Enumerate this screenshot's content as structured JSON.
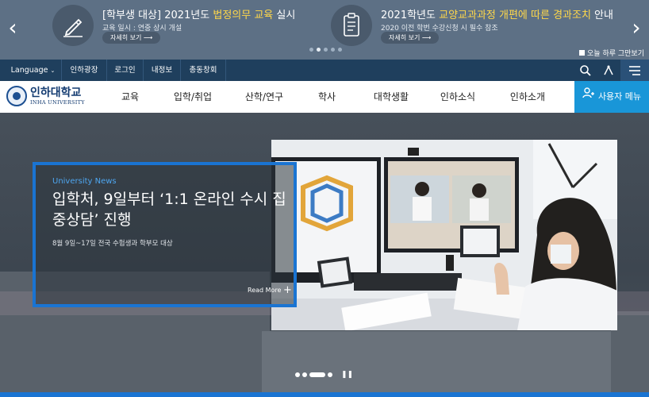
{
  "notice": {
    "items": [
      {
        "prefix": "[학부생 대상] 2021년도 ",
        "highlight": "법정의무 교육",
        "suffix": " 실시",
        "sub": "교육 일시 : 연중 상시 개설",
        "more": "자세히 보기"
      },
      {
        "prefix": "2021학년도 ",
        "highlight": "교양교과과정 개편에 따른 경과조치",
        "suffix": " 안내",
        "sub": "2020 이전 학번 수강신청 시 필수 참조",
        "more": "자세히 보기"
      }
    ],
    "prev_icon": "‹",
    "next_icon": "›",
    "today_close": "오늘 하루 그만보기"
  },
  "util_nav": {
    "items": [
      "Language",
      "인하광장",
      "로그인",
      "내정보",
      "총동창회"
    ],
    "icons": [
      "search-icon",
      "sitemap-icon",
      "menu-icon"
    ]
  },
  "logo": {
    "name": "인하대학교",
    "sub": "INHA UNIVERSITY"
  },
  "gnb": {
    "items": [
      "교육",
      "입학/취업",
      "산학/연구",
      "학사",
      "대학생활",
      "인하소식",
      "인하소개"
    ],
    "user_menu": "사용자 메뉴"
  },
  "hero": {
    "label": "University News",
    "title": "입학처, 9일부터 ‘1:1 온라인 수시 집중상담’ 진행",
    "sub": "8월 9일~17일 전국 수험생과 학부모 대상",
    "read_more": "Read More"
  },
  "colors": {
    "accent": "#1996d8",
    "navy": "#1f3f5d",
    "highlight": "#ffd84a",
    "frame": "#1a74d2"
  }
}
